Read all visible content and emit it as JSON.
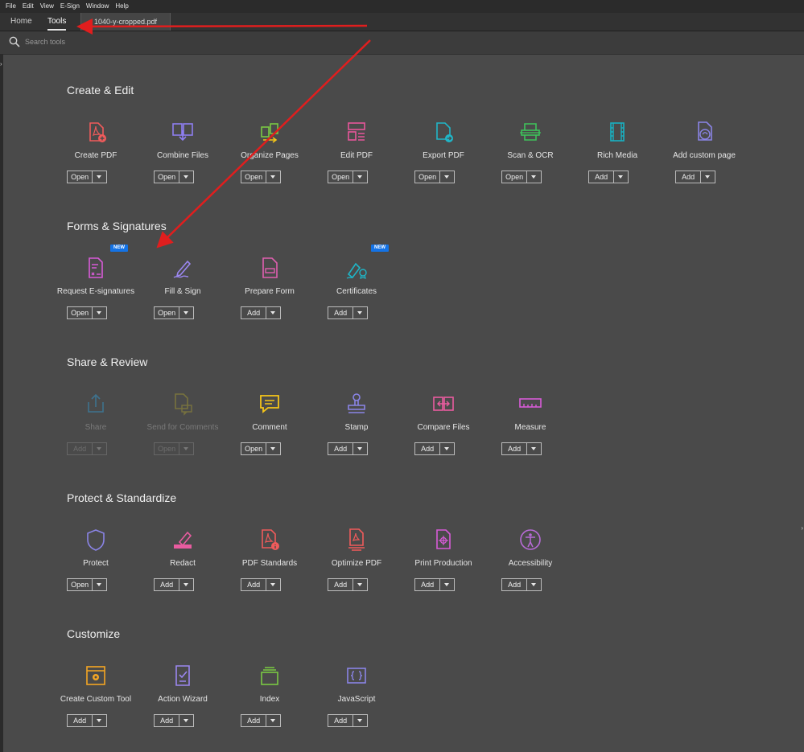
{
  "menubar": {
    "items": [
      "File",
      "Edit",
      "View",
      "E-Sign",
      "Window",
      "Help"
    ]
  },
  "tabs": {
    "home": "Home",
    "tools": "Tools",
    "document": "1040-y-cropped.pdf"
  },
  "search": {
    "placeholder": "Search tools"
  },
  "colors": {
    "accent_badge": "#1473e6",
    "annotation_arrow": "#e01e1e",
    "background": "#4a4a4a"
  },
  "sections": [
    {
      "title": "Create & Edit",
      "tools": [
        {
          "label": "Create PDF",
          "button": "Open",
          "icon": "create-pdf-icon",
          "color": "#f05b5b"
        },
        {
          "label": "Combine Files",
          "button": "Open",
          "icon": "combine-files-icon",
          "color": "#8e7ef0"
        },
        {
          "label": "Organize Pages",
          "button": "Open",
          "icon": "organize-pages-icon",
          "color": "#7ac943"
        },
        {
          "label": "Edit PDF",
          "button": "Open",
          "icon": "edit-pdf-icon",
          "color": "#e8569b"
        },
        {
          "label": "Export PDF",
          "button": "Open",
          "icon": "export-pdf-icon",
          "color": "#20b6c8"
        },
        {
          "label": "Scan & OCR",
          "button": "Open",
          "icon": "scan-ocr-icon",
          "color": "#3ec35b"
        },
        {
          "label": "Rich Media",
          "button": "Add",
          "icon": "rich-media-icon",
          "color": "#18b1c2"
        },
        {
          "label": "Add custom page",
          "button": "Add",
          "icon": "add-custom-page-icon",
          "color": "#8a84e6"
        }
      ]
    },
    {
      "title": "Forms & Signatures",
      "tools": [
        {
          "label": "Request E-signatures",
          "button": "Open",
          "icon": "request-esignatures-icon",
          "color": "#d85bd8",
          "badge": "NEW"
        },
        {
          "label": "Fill & Sign",
          "button": "Open",
          "icon": "fill-sign-icon",
          "color": "#9b87f0"
        },
        {
          "label": "Prepare Form",
          "button": "Add",
          "icon": "prepare-form-icon",
          "color": "#e05fb0"
        },
        {
          "label": "Certificates",
          "button": "Add",
          "icon": "certificates-icon",
          "color": "#1fb5c6",
          "badge": "NEW"
        }
      ]
    },
    {
      "title": "Share & Review",
      "tools": [
        {
          "label": "Share",
          "button": "Add",
          "icon": "share-icon",
          "color": "#3d7a9a",
          "disabled": true
        },
        {
          "label": "Send for Comments",
          "button": "Open",
          "icon": "send-for-comments-icon",
          "color": "#7f7a3c",
          "disabled": true
        },
        {
          "label": "Comment",
          "button": "Open",
          "icon": "comment-icon",
          "color": "#f5c518"
        },
        {
          "label": "Stamp",
          "button": "Add",
          "icon": "stamp-icon",
          "color": "#8a84e6"
        },
        {
          "label": "Compare Files",
          "button": "Add",
          "icon": "compare-files-icon",
          "color": "#e95ca0"
        },
        {
          "label": "Measure",
          "button": "Add",
          "icon": "measure-icon",
          "color": "#d85bd8"
        }
      ]
    },
    {
      "title": "Protect & Standardize",
      "tools": [
        {
          "label": "Protect",
          "button": "Open",
          "icon": "protect-icon",
          "color": "#8a84e6"
        },
        {
          "label": "Redact",
          "button": "Add",
          "icon": "redact-icon",
          "color": "#e95ca0"
        },
        {
          "label": "PDF Standards",
          "button": "Add",
          "icon": "pdf-standards-icon",
          "color": "#f05b5b"
        },
        {
          "label": "Optimize PDF",
          "button": "Add",
          "icon": "optimize-pdf-icon",
          "color": "#f05b5b"
        },
        {
          "label": "Print Production",
          "button": "Add",
          "icon": "print-production-icon",
          "color": "#d85bd8"
        },
        {
          "label": "Accessibility",
          "button": "Add",
          "icon": "accessibility-icon",
          "color": "#b86bd8"
        }
      ]
    },
    {
      "title": "Customize",
      "tools": [
        {
          "label": "Create Custom Tool",
          "button": "Add",
          "icon": "create-custom-tool-icon",
          "color": "#f5a623"
        },
        {
          "label": "Action Wizard",
          "button": "Add",
          "icon": "action-wizard-icon",
          "color": "#9b87f0"
        },
        {
          "label": "Index",
          "button": "Add",
          "icon": "index-icon",
          "color": "#7ac943"
        },
        {
          "label": "JavaScript",
          "button": "Add",
          "icon": "javascript-icon",
          "color": "#8a84e6"
        }
      ]
    }
  ]
}
